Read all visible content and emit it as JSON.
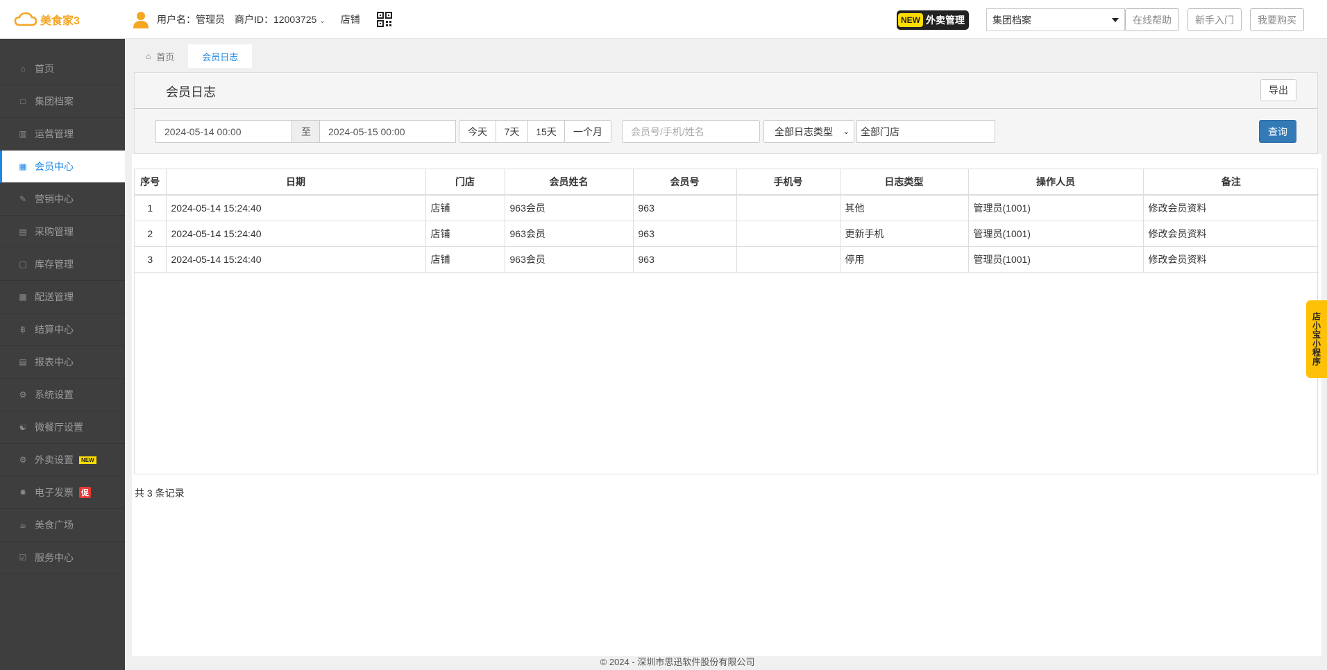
{
  "app": {
    "name": "美食家3",
    "brand_color": "#f5a623"
  },
  "user": {
    "label": "用户名：管理员",
    "merchant": "商户ID：12003725",
    "store": "店铺"
  },
  "header": {
    "waimai_new": "NEW",
    "waimai_label": "外卖管理",
    "archive_select": "集团档案",
    "help": "在线帮助",
    "beginner": "新手入门",
    "buy": "我要购买"
  },
  "sidebar": {
    "items": [
      {
        "label": "首页",
        "icon": "home-icon"
      },
      {
        "label": "集团档案",
        "icon": "archive-icon"
      },
      {
        "label": "运营管理",
        "icon": "bar-chart-icon"
      },
      {
        "label": "会员中心",
        "icon": "id-card-icon"
      },
      {
        "label": "营销中心",
        "icon": "edit-icon"
      },
      {
        "label": "采购管理",
        "icon": "book-icon"
      },
      {
        "label": "库存管理",
        "icon": "file-icon"
      },
      {
        "label": "配送管理",
        "icon": "truck-icon"
      },
      {
        "label": "结算中心",
        "icon": "bitcoin-icon"
      },
      {
        "label": "报表中心",
        "icon": "report-icon"
      },
      {
        "label": "系统设置",
        "icon": "cogs-icon"
      },
      {
        "label": "微餐厅设置",
        "icon": "cutlery-icon"
      },
      {
        "label": "外卖设置",
        "icon": "gear-icon",
        "badge": "NEW"
      },
      {
        "label": "电子发票",
        "icon": "star-icon",
        "badge": "促"
      },
      {
        "label": "美食广场",
        "icon": "coffee-icon"
      },
      {
        "label": "服务中心",
        "icon": "check-square-icon"
      }
    ],
    "active_index": 3
  },
  "tabs": [
    {
      "label": "首页",
      "icon": "home-icon"
    },
    {
      "label": "会员日志"
    }
  ],
  "panel": {
    "title": "会员日志",
    "export": "导出",
    "date_from": "2024-05-14 00:00",
    "to": "至",
    "date_to": "2024-05-15 00:00",
    "quick": [
      "今天",
      "7天",
      "15天",
      "一个月"
    ],
    "search_placeholder": "会员号/手机/姓名",
    "log_type": "全部日志类型",
    "store_value": "全部门店",
    "query": "查询"
  },
  "table": {
    "headers": [
      "序号",
      "日期",
      "门店",
      "会员姓名",
      "会员号",
      "手机号",
      "日志类型",
      "操作人员",
      "备注"
    ],
    "rows": [
      [
        "1",
        "2024-05-14 15:24:40",
        "店铺",
        "963会员",
        "963",
        "",
        "其他",
        "管理员(1001)",
        "修改会员资料"
      ],
      [
        "2",
        "2024-05-14 15:24:40",
        "店铺",
        "963会员",
        "963",
        "",
        "更新手机",
        "管理员(1001)",
        "修改会员资料"
      ],
      [
        "3",
        "2024-05-14 15:24:40",
        "店铺",
        "963会员",
        "963",
        "",
        "停用",
        "管理员(1001)",
        "修改会员资料"
      ]
    ]
  },
  "total": "共 3 条记录",
  "footer": "© 2024 - 深圳市思迅软件股份有限公司",
  "float_tab": "店小宝小程序",
  "colors": {
    "accent": "#1e88e5",
    "primary_btn": "#337ab7",
    "sidebar_bg": "#3e3e3e"
  }
}
